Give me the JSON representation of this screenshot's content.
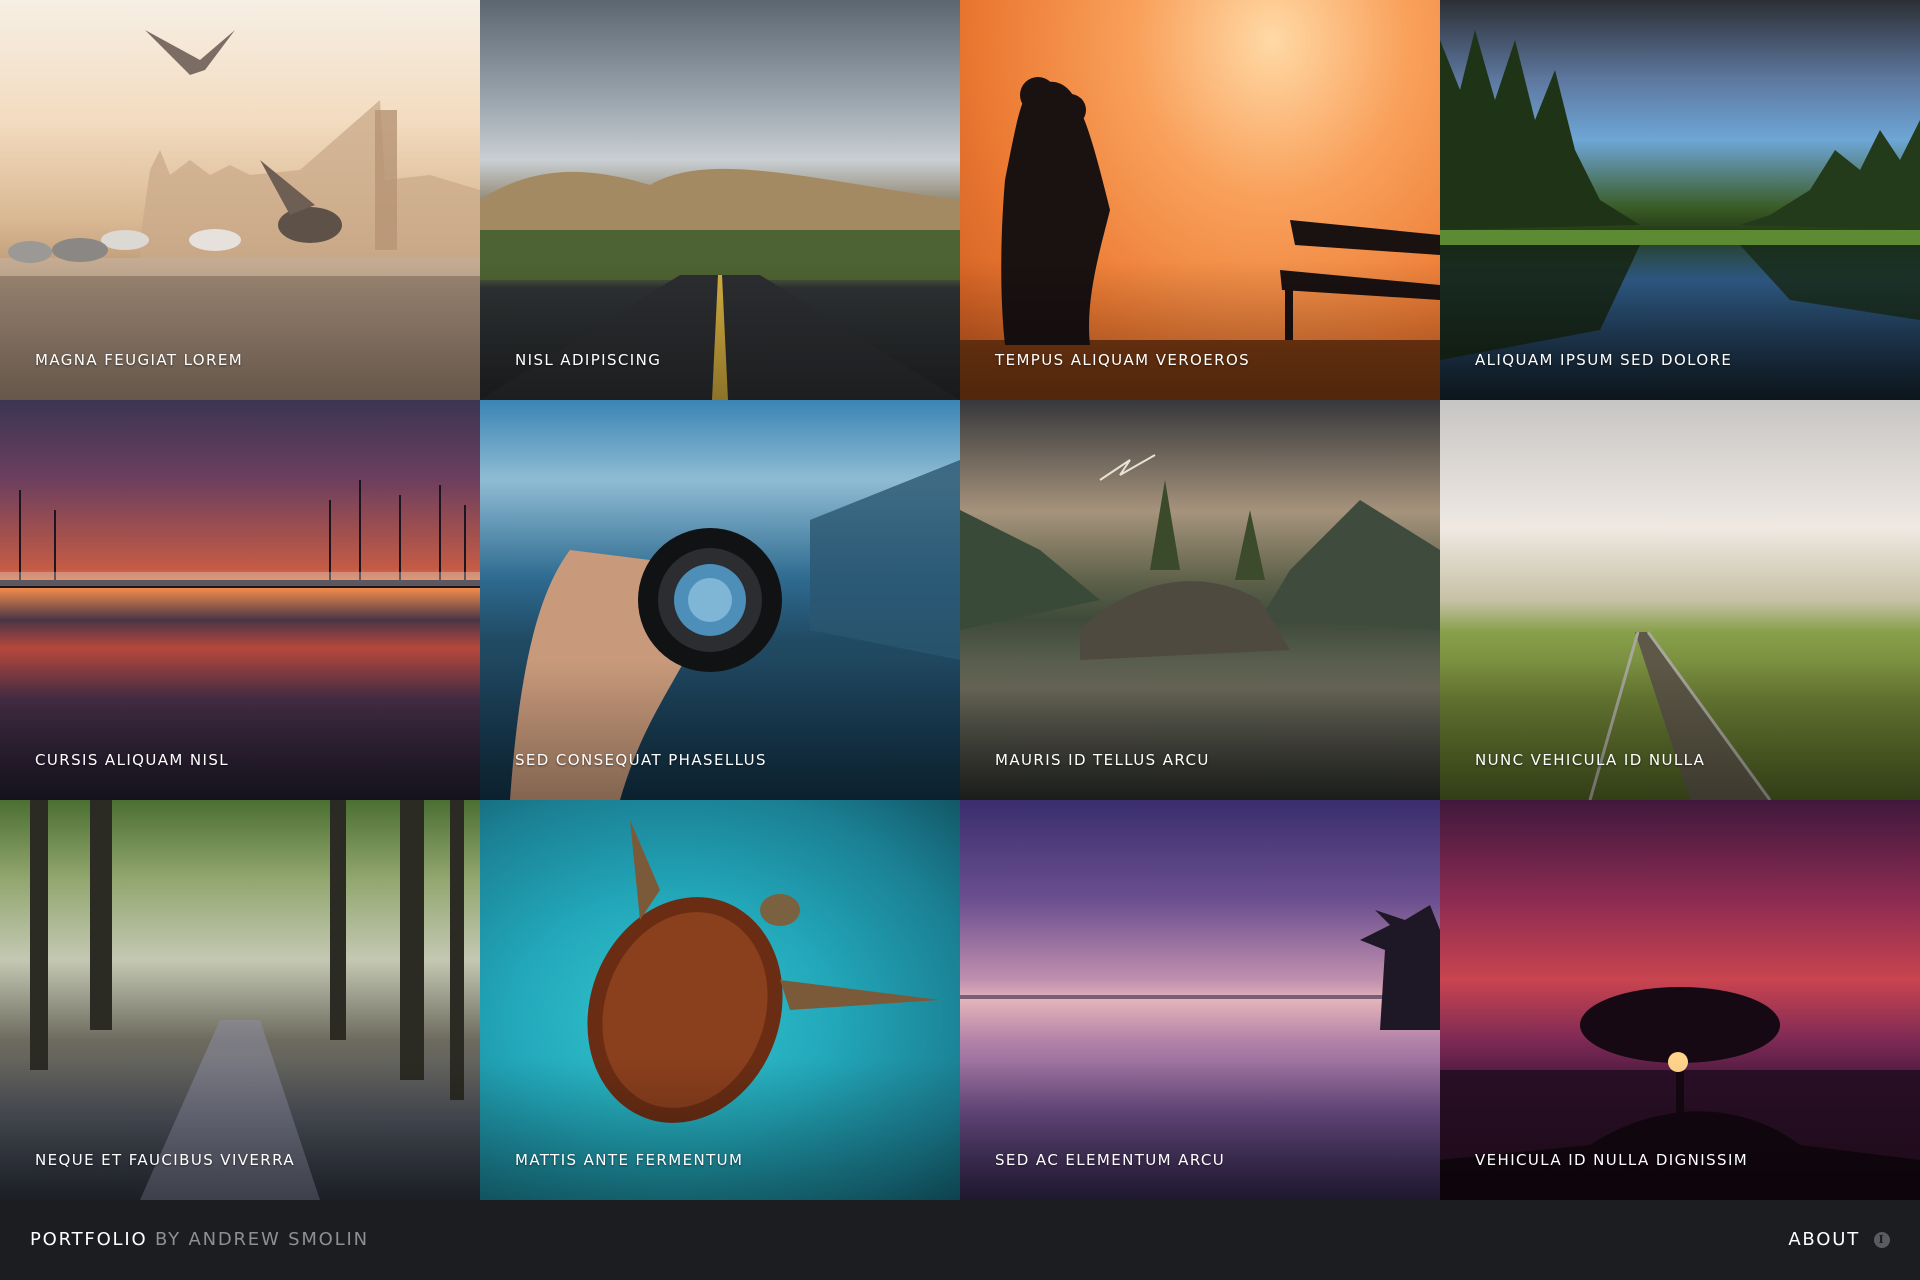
{
  "gallery": {
    "items": [
      {
        "caption": "Magna feugiat lorem"
      },
      {
        "caption": "Nisl adipiscing"
      },
      {
        "caption": "Tempus aliquam veroeros"
      },
      {
        "caption": "Aliquam ipsum sed dolore"
      },
      {
        "caption": "Cursis aliquam nisl"
      },
      {
        "caption": "Sed consequat phasellus"
      },
      {
        "caption": "Mauris id tellus arcu"
      },
      {
        "caption": "Nunc vehicula id nulla"
      },
      {
        "caption": "Neque et faucibus viverra"
      },
      {
        "caption": "Mattis ante fermentum"
      },
      {
        "caption": "Sed ac elementum arcu"
      },
      {
        "caption": "Vehicula id nulla dignissim"
      }
    ]
  },
  "footer": {
    "brand": "Portfolio",
    "byline": "by Andrew Smolin",
    "about_label": "About",
    "about_icon": "info-icon"
  },
  "colors": {
    "footer_bg": "#1c1d21",
    "byline": "#8e8f93",
    "caption_text": "#ffffff"
  }
}
